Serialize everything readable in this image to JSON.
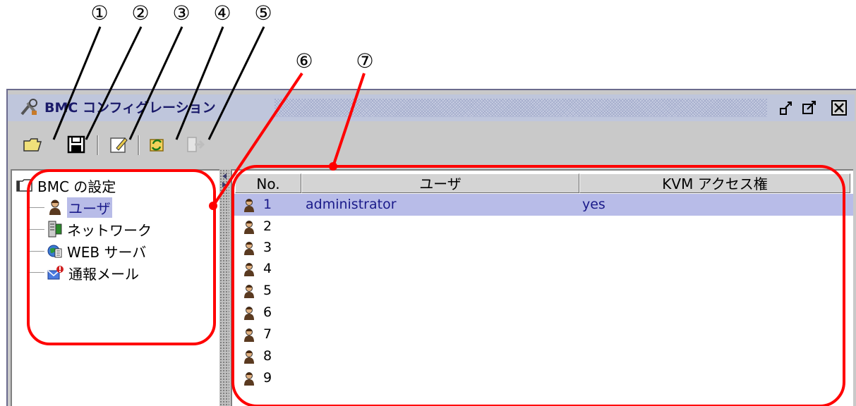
{
  "callouts": [
    "①",
    "②",
    "③",
    "④",
    "⑤",
    "⑥",
    "⑦"
  ],
  "window": {
    "title": "BMC コンフィグレーション",
    "icon": "tools-icon"
  },
  "toolbar": {
    "buttons": [
      "open-folder-icon",
      "save-icon",
      "edit-icon",
      "refresh-icon",
      "export-icon"
    ]
  },
  "tree": {
    "root": "BMC の設定",
    "items": [
      {
        "label": "ユーザ",
        "icon": "user-icon",
        "selected": true
      },
      {
        "label": "ネットワーク",
        "icon": "network-icon"
      },
      {
        "label": "WEB サーバ",
        "icon": "web-server-icon"
      },
      {
        "label": "通報メール",
        "icon": "alert-mail-icon"
      }
    ]
  },
  "table": {
    "columns": [
      "No.",
      "ユーザ",
      "KVM アクセス権"
    ],
    "rows": [
      {
        "no": "1",
        "user": "administrator",
        "kvm": "yes",
        "selected": true
      },
      {
        "no": "2",
        "user": "",
        "kvm": ""
      },
      {
        "no": "3",
        "user": "",
        "kvm": ""
      },
      {
        "no": "4",
        "user": "",
        "kvm": ""
      },
      {
        "no": "5",
        "user": "",
        "kvm": ""
      },
      {
        "no": "6",
        "user": "",
        "kvm": ""
      },
      {
        "no": "7",
        "user": "",
        "kvm": ""
      },
      {
        "no": "8",
        "user": "",
        "kvm": ""
      },
      {
        "no": "9",
        "user": "",
        "kvm": ""
      }
    ]
  },
  "colors": {
    "highlight": "#b8bce8",
    "annotation": "#ff0000",
    "title_text": "#1a1a6a"
  }
}
